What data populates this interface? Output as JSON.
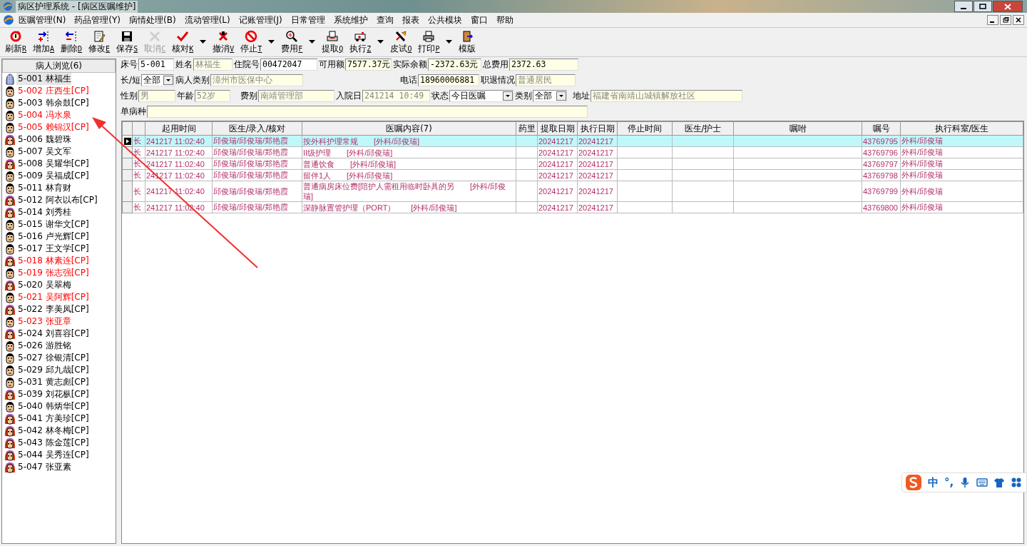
{
  "window": {
    "title": "病区护理系统 - [病区医嘱维护]"
  },
  "menu": [
    "医嘱管理(N)",
    "药品管理(Y)",
    "病情处理(B)",
    "流动管理(L)",
    "记账管理(J)",
    "日常管理",
    "系统维护",
    "查询",
    "报表",
    "公共模块",
    "窗口",
    "帮助"
  ],
  "toolbar": [
    {
      "label": "刷新",
      "key": "R",
      "disabled": false,
      "dropdown": false
    },
    {
      "label": "增加",
      "key": "A",
      "disabled": false,
      "dropdown": false
    },
    {
      "label": "删除",
      "key": "D",
      "disabled": false,
      "dropdown": false
    },
    {
      "label": "修改",
      "key": "E",
      "disabled": false,
      "dropdown": false
    },
    {
      "label": "保存",
      "key": "S",
      "disabled": false,
      "dropdown": false
    },
    {
      "label": "取消",
      "key": "C",
      "disabled": true,
      "dropdown": false
    },
    {
      "label": "核对",
      "key": "K",
      "disabled": false,
      "dropdown": true
    },
    {
      "label": "撤消",
      "key": "V",
      "disabled": false,
      "dropdown": false
    },
    {
      "label": "停止",
      "key": "T",
      "disabled": false,
      "dropdown": true
    },
    {
      "label": "费用",
      "key": "F",
      "disabled": false,
      "dropdown": true
    },
    {
      "label": "提取",
      "key": "Q",
      "disabled": false,
      "dropdown": false
    },
    {
      "label": "执行",
      "key": "Z",
      "disabled": false,
      "dropdown": true
    },
    {
      "label": "皮试",
      "key": "O",
      "disabled": false,
      "dropdown": false
    },
    {
      "label": "打印",
      "key": "P",
      "disabled": false,
      "dropdown": true
    },
    {
      "label": "模版",
      "disabled": false,
      "dropdown": false
    }
  ],
  "patients": {
    "title": "病人浏览(6)",
    "items": [
      {
        "label": "5-001 林福生",
        "kind": "selected",
        "color": "#000000",
        "selected": true
      },
      {
        "label": "5-002 庄西生[CP]",
        "kind": "male",
        "color": "#ff0000",
        "selected": false
      },
      {
        "label": "5-003 韩余鼓[CP]",
        "kind": "male",
        "color": "#000000",
        "selected": false
      },
      {
        "label": "5-004 冯水泉",
        "kind": "male",
        "color": "#ff0000",
        "selected": false
      },
      {
        "label": "5-005 赖锦汉[CP]",
        "kind": "male",
        "color": "#ff0000",
        "selected": false
      },
      {
        "label": "5-006 魏碧珠",
        "kind": "female",
        "color": "#000000",
        "selected": false
      },
      {
        "label": "5-007 吴文军",
        "kind": "male",
        "color": "#000000",
        "selected": false
      },
      {
        "label": "5-008 吴耀华[CP]",
        "kind": "female",
        "color": "#000000",
        "selected": false
      },
      {
        "label": "5-009 吴福成[CP]",
        "kind": "male",
        "color": "#000000",
        "selected": false
      },
      {
        "label": "5-011 林育财",
        "kind": "male",
        "color": "#000000",
        "selected": false
      },
      {
        "label": "5-012 阿衣以布[CP]",
        "kind": "female",
        "color": "#000000",
        "selected": false
      },
      {
        "label": "5-014 刘秀桂",
        "kind": "female",
        "color": "#000000",
        "selected": false
      },
      {
        "label": "5-015 谢华文[CP]",
        "kind": "male",
        "color": "#000000",
        "selected": false
      },
      {
        "label": "5-016 卢光辉[CP]",
        "kind": "male",
        "color": "#000000",
        "selected": false
      },
      {
        "label": "5-017 王文学[CP]",
        "kind": "male",
        "color": "#000000",
        "selected": false
      },
      {
        "label": "5-018 林素连[CP]",
        "kind": "female",
        "color": "#ff0000",
        "selected": false
      },
      {
        "label": "5-019 张志强[CP]",
        "kind": "male",
        "color": "#ff0000",
        "selected": false
      },
      {
        "label": "5-020 吴翠梅",
        "kind": "female",
        "color": "#000000",
        "selected": false
      },
      {
        "label": "5-021 吴阿辉[CP]",
        "kind": "male",
        "color": "#ff0000",
        "selected": false
      },
      {
        "label": "5-022 李美凤[CP]",
        "kind": "female",
        "color": "#000000",
        "selected": false
      },
      {
        "label": "5-023 张亚章",
        "kind": "male",
        "color": "#ff0000",
        "selected": false
      },
      {
        "label": "5-024 刘喜容[CP]",
        "kind": "female",
        "color": "#000000",
        "selected": false
      },
      {
        "label": "5-026 游胜铭",
        "kind": "male",
        "color": "#000000",
        "selected": false
      },
      {
        "label": "5-027 徐银清[CP]",
        "kind": "male",
        "color": "#000000",
        "selected": false
      },
      {
        "label": "5-029 邱九哉[CP]",
        "kind": "male",
        "color": "#000000",
        "selected": false
      },
      {
        "label": "5-031 黄志彪[CP]",
        "kind": "male",
        "color": "#000000",
        "selected": false
      },
      {
        "label": "5-039 刘花枞[CP]",
        "kind": "female",
        "color": "#000000",
        "selected": false
      },
      {
        "label": "5-040 韩炳华[CP]",
        "kind": "male",
        "color": "#000000",
        "selected": false
      },
      {
        "label": "5-041 方美珍[CP]",
        "kind": "female",
        "color": "#000000",
        "selected": false
      },
      {
        "label": "5-042 林冬梅[CP]",
        "kind": "female",
        "color": "#000000",
        "selected": false
      },
      {
        "label": "5-043 陈金莲[CP]",
        "kind": "female",
        "color": "#000000",
        "selected": false
      },
      {
        "label": "5-044 吴秀连[CP]",
        "kind": "female",
        "color": "#000000",
        "selected": false
      },
      {
        "label": "5-047 张亚素",
        "kind": "female",
        "color": "#000000",
        "selected": false
      }
    ]
  },
  "form": {
    "rows": [
      {
        "fields": [
          {
            "label": "床号",
            "value": "5-001",
            "kind": "input"
          },
          {
            "label": "姓名",
            "value": "林福生",
            "kind": "readonly"
          },
          {
            "label": "住院号",
            "value": "00472047",
            "kind": "input"
          },
          {
            "label": "可用额",
            "value": "7577.37元",
            "kind": "value"
          },
          {
            "label": "实际余额",
            "value": "-2372.63元",
            "kind": "value"
          },
          {
            "label": "总费用",
            "value": "2372.63",
            "kind": "value"
          }
        ]
      },
      {
        "fields": [
          {
            "label": "长/短",
            "value": "全部",
            "kind": "select"
          },
          {
            "label": "病人类别",
            "value": "漳州市医保中心",
            "kind": "readonly"
          },
          {
            "label": "电话",
            "value": "18960006881",
            "kind": "value"
          },
          {
            "label": "职退情况",
            "value": "普通居民",
            "kind": "readonly"
          }
        ]
      },
      {
        "fields": [
          {
            "label": "性别",
            "value": "男",
            "kind": "readonly"
          },
          {
            "label": "年龄",
            "value": "52岁",
            "kind": "readonly"
          },
          {
            "label": "费别",
            "value": "南靖管理部",
            "kind": "readonly"
          },
          {
            "label": "入院日",
            "value": "241214 10:49",
            "kind": "readonly"
          },
          {
            "label": "状态",
            "value": "今日医嘱",
            "kind": "select"
          },
          {
            "label": "类别",
            "value": "全部",
            "kind": "select"
          },
          {
            "label": "地址",
            "value": "福建省南靖山城镇解放社区",
            "kind": "readonly"
          }
        ]
      },
      {
        "fields": [
          {
            "label": "单病种",
            "kind": "readonly"
          }
        ]
      }
    ]
  },
  "table": {
    "columns": [
      "起用时间",
      "医生/录入/核对",
      "医嘱内容(7)",
      "药里",
      "提取日期",
      "执行日期",
      "停止时间",
      "医生/护士",
      "嘱咐",
      "嘱号",
      "执行科室/医生"
    ],
    "rows": [
      {
        "selected": true,
        "term": "长",
        "start_time": "241217 11:02:40",
        "doctors": "邱俊瑞/邱俊瑞/郑艳霞",
        "content": "按外科护理常规　　[外科/邱俊瑞]",
        "fetch_date": "20241217",
        "exec_date": "20241217",
        "order_no": "43769795",
        "dept": "外科/邱俊瑞"
      },
      {
        "selected": false,
        "term": "长",
        "start_time": "241217 11:02:40",
        "doctors": "邱俊瑞/邱俊瑞/郑艳霞",
        "content": "II级护理　　[外科/邱俊瑞]",
        "fetch_date": "20241217",
        "exec_date": "20241217",
        "order_no": "43769796",
        "dept": "外科/邱俊瑞"
      },
      {
        "selected": false,
        "term": "长",
        "start_time": "241217 11:02:40",
        "doctors": "邱俊瑞/邱俊瑞/郑艳霞",
        "content": "普通饮食　　[外科/邱俊瑞]",
        "fetch_date": "20241217",
        "exec_date": "20241217",
        "order_no": "43769797",
        "dept": "外科/邱俊瑞"
      },
      {
        "selected": false,
        "term": "长",
        "start_time": "241217 11:02:40",
        "doctors": "邱俊瑞/邱俊瑞/郑艳霞",
        "content": "留伴1人　　[外科/邱俊瑞]",
        "fetch_date": "20241217",
        "exec_date": "20241217",
        "order_no": "43769798",
        "dept": "外科/邱俊瑞"
      },
      {
        "selected": false,
        "term": "长",
        "start_time": "241217 11:02:40",
        "doctors": "邱俊瑞/邱俊瑞/郑艳霞",
        "content": "普通病房床位费[陪护人需租用临时卧具的另　　[外科/邱俊瑞]",
        "fetch_date": "20241217",
        "exec_date": "20241217",
        "order_no": "43769799",
        "dept": "外科/邱俊瑞"
      },
      {
        "selected": false,
        "term": "长",
        "start_time": "241217 11:02:40",
        "doctors": "邱俊瑞/邱俊瑞/郑艳霞",
        "content": "深静脉置管护理（PORT）　　[外科/邱俊瑞]",
        "fetch_date": "20241217",
        "exec_date": "20241217",
        "order_no": "43769800",
        "dept": "外科/邱俊瑞"
      }
    ]
  },
  "ime_bar": {
    "mode": "中",
    "punctuation": "°,"
  }
}
